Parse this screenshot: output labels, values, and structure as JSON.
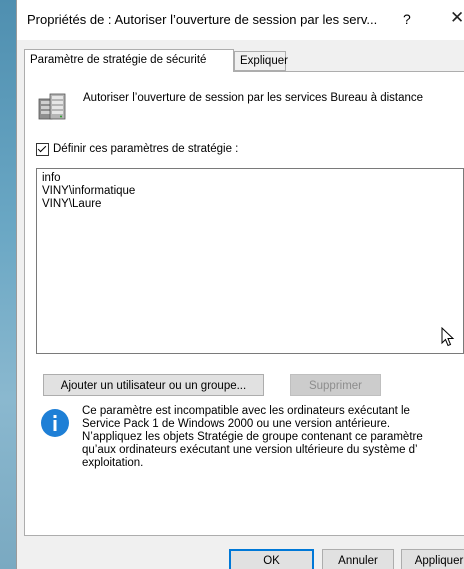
{
  "window": {
    "title": "Propriétés de : Autoriser l’ouverture de session par les serv...",
    "help_label": "?",
    "close_label": "✕"
  },
  "tabs": [
    {
      "label": "Paramètre de stratégie de sécurité",
      "active": true
    },
    {
      "label": "Expliquer",
      "active": false
    }
  ],
  "policy": {
    "icon": "server-policy-icon",
    "title": "Autoriser l’ouverture de session par les services Bureau à distance"
  },
  "define_checkbox": {
    "label": "Définir ces paramètres de stratégie :",
    "checked": true
  },
  "members": [
    "info",
    "VINY\\informatique",
    "VINY\\Laure"
  ],
  "buttons": {
    "add": "Ajouter un utilisateur ou un groupe...",
    "remove": "Supprimer",
    "ok": "OK",
    "cancel": "Annuler",
    "apply": "Appliquer"
  },
  "info": {
    "icon": "info-icon",
    "text": "Ce paramètre est incompatible avec les ordinateurs exécutant le\nService Pack 1 de Windows 2000 ou une version antérieure.\nN’appliquez les objets Stratégie de groupe contenant ce paramètre\nqu’aux ordinateurs exécutant une version ultérieure du système d’\nexploitation."
  },
  "colors": {
    "accent": "#0078d7",
    "info_blue": "#1e7fd6",
    "dialog_bg": "#f0f0f0",
    "desktop_bg": "#5e8ea6"
  }
}
